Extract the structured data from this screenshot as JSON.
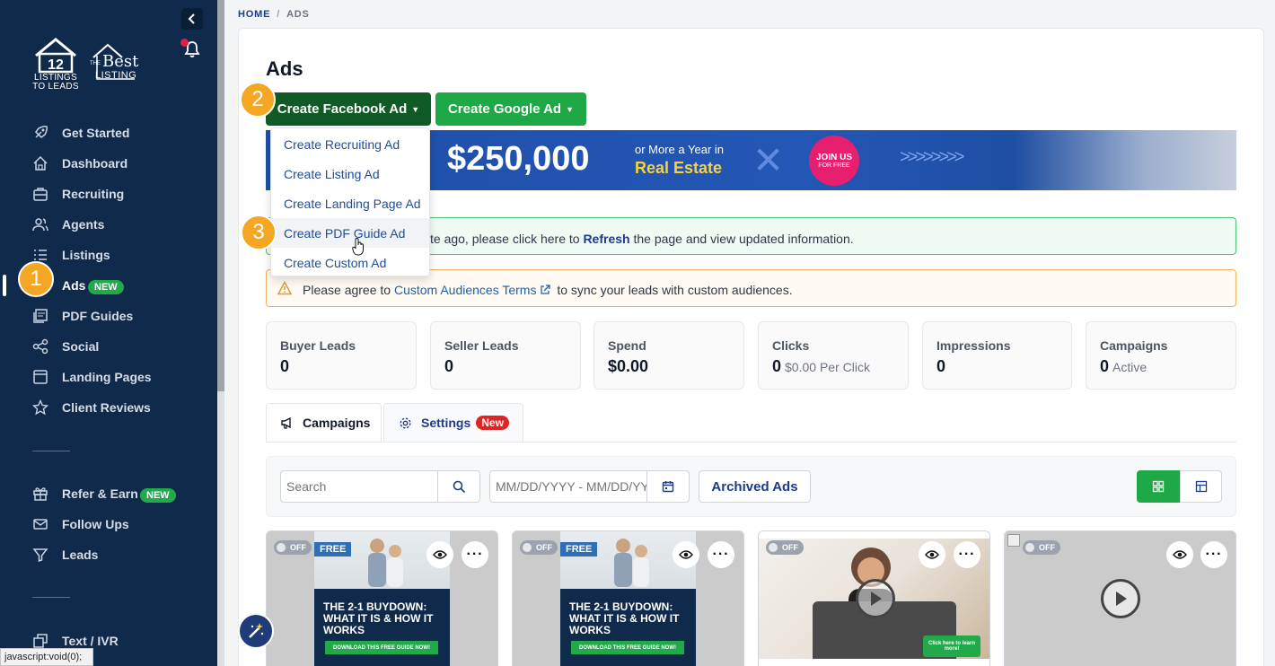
{
  "sidebar": {
    "logo_primary": {
      "mark": "12",
      "line1": "LISTINGS",
      "line2": "TO LEADS"
    },
    "logo_secondary": {
      "the": "THE",
      "best": "Best",
      "listing": "LISTING"
    },
    "items": [
      {
        "label": "Get Started",
        "icon": "rocket-icon"
      },
      {
        "label": "Dashboard",
        "icon": "home-icon"
      },
      {
        "label": "Recruiting",
        "icon": "briefcase-icon"
      },
      {
        "label": "Agents",
        "icon": "users-icon"
      },
      {
        "label": "Listings",
        "icon": "list-icon"
      },
      {
        "label": "Ads",
        "icon": "megaphone-icon",
        "badge": "NEW",
        "active": true
      },
      {
        "label": "PDF Guides",
        "icon": "pdf-icon"
      },
      {
        "label": "Social",
        "icon": "share-icon"
      },
      {
        "label": "Landing Pages",
        "icon": "window-icon"
      },
      {
        "label": "Client Reviews",
        "icon": "star-icon"
      }
    ],
    "items2": [
      {
        "label": "Refer & Earn",
        "icon": "gift-icon",
        "badge": "NEW"
      },
      {
        "label": "Follow Ups",
        "icon": "mail-icon"
      },
      {
        "label": "Leads",
        "icon": "filter-icon"
      }
    ],
    "items3": [
      {
        "label": "Text / IVR",
        "icon": "chat-icon"
      }
    ]
  },
  "steps": {
    "one": "1",
    "two": "2",
    "three": "3"
  },
  "status_bar": "javascript:void(0);",
  "breadcrumb": {
    "home": "HOME",
    "sep": "/",
    "current": "ADS"
  },
  "page": {
    "title": "Ads"
  },
  "buttons": {
    "facebook": "Create Facebook Ad",
    "google": "Create Google Ad"
  },
  "dropdown": [
    "Create Recruiting Ad",
    "Create Listing Ad",
    "Create Landing Page Ad",
    "Create PDF Guide Ad",
    "Create Custom Ad"
  ],
  "banner": {
    "amount": "$250,000",
    "sub1": "or More a Year in",
    "sub2": "Real Estate",
    "join1": "JOIN US",
    "join2": "FOR FREE"
  },
  "alerts": {
    "refresh_prefix": "te ago, please click here to ",
    "refresh_link": "Refresh",
    "refresh_suffix": " the page and view updated information.",
    "terms_prefix": "Please agree to ",
    "terms_link": "Custom Audiences Terms",
    "terms_suffix": " to sync your leads with custom audiences."
  },
  "stats": [
    {
      "label": "Buyer Leads",
      "value": "0",
      "sub": ""
    },
    {
      "label": "Seller Leads",
      "value": "0",
      "sub": ""
    },
    {
      "label": "Spend",
      "value": "$0.00",
      "sub": ""
    },
    {
      "label": "Clicks",
      "value": "0",
      "sub": "$0.00 Per Click"
    },
    {
      "label": "Impressions",
      "value": "0",
      "sub": ""
    },
    {
      "label": "Campaigns",
      "value": "0",
      "sub": "Active"
    }
  ],
  "tabs": {
    "campaigns": "Campaigns",
    "settings": "Settings",
    "settings_badge": "New"
  },
  "toolbar": {
    "search_placeholder": "Search",
    "date_placeholder": "MM/DD/YYYY - MM/DD/YYYY",
    "archived": "Archived Ads"
  },
  "ads": {
    "off": "OFF",
    "free": "FREE",
    "guide_title": "THE 2-1 BUYDOWN: WHAT IT IS & HOW IT WORKS",
    "guide_cta": "DOWNLOAD THIS FREE GUIDE NOW!",
    "learn_more": "Click here to learn more!"
  }
}
